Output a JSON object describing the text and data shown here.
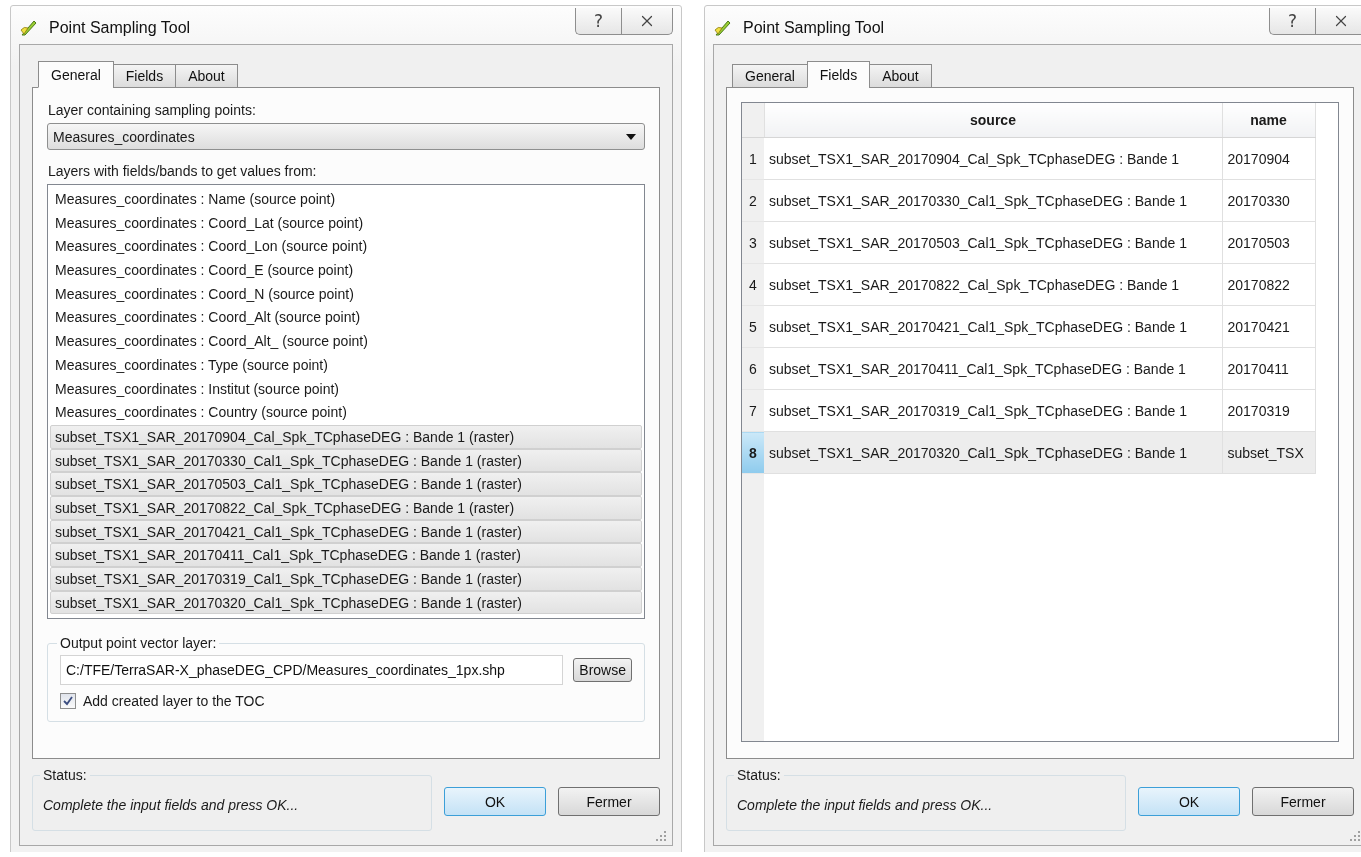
{
  "windows": [
    {
      "kind": "general",
      "title": "Point Sampling Tool",
      "help": "?",
      "tabs": [
        {
          "label": "General",
          "selected": true
        },
        {
          "label": "Fields",
          "selected": false
        },
        {
          "label": "About",
          "selected": false
        }
      ],
      "sampling_label": "Layer containing sampling points:",
      "sampling_layer": "Measures_coordinates",
      "layers_label": "Layers with fields/bands to get values from:",
      "layers": [
        {
          "label": "Measures_coordinates : Name (source point)",
          "selected": false
        },
        {
          "label": "Measures_coordinates : Coord_Lat (source point)",
          "selected": false
        },
        {
          "label": "Measures_coordinates : Coord_Lon (source point)",
          "selected": false
        },
        {
          "label": "Measures_coordinates : Coord_E (source point)",
          "selected": false
        },
        {
          "label": "Measures_coordinates : Coord_N (source point)",
          "selected": false
        },
        {
          "label": "Measures_coordinates : Coord_Alt (source point)",
          "selected": false
        },
        {
          "label": "Measures_coordinates : Coord_Alt_ (source point)",
          "selected": false
        },
        {
          "label": "Measures_coordinates : Type (source point)",
          "selected": false
        },
        {
          "label": "Measures_coordinates : Institut (source point)",
          "selected": false
        },
        {
          "label": "Measures_coordinates : Country (source point)",
          "selected": false
        },
        {
          "label": "subset_TSX1_SAR_20170904_Cal_Spk_TCphaseDEG : Bande 1 (raster)",
          "selected": true
        },
        {
          "label": "subset_TSX1_SAR_20170330_Cal1_Spk_TCphaseDEG : Bande 1 (raster)",
          "selected": true
        },
        {
          "label": "subset_TSX1_SAR_20170503_Cal1_Spk_TCphaseDEG : Bande 1 (raster)",
          "selected": true
        },
        {
          "label": "subset_TSX1_SAR_20170822_Cal_Spk_TCphaseDEG : Bande 1 (raster)",
          "selected": true
        },
        {
          "label": "subset_TSX1_SAR_20170421_Cal1_Spk_TCphaseDEG : Bande 1 (raster)",
          "selected": true
        },
        {
          "label": "subset_TSX1_SAR_20170411_Cal1_Spk_TCphaseDEG : Bande 1 (raster)",
          "selected": true
        },
        {
          "label": "subset_TSX1_SAR_20170319_Cal1_Spk_TCphaseDEG : Bande 1 (raster)",
          "selected": true
        },
        {
          "label": "subset_TSX1_SAR_20170320_Cal1_Spk_TCphaseDEG : Bande 1 (raster)",
          "selected": true
        }
      ],
      "output": {
        "legend": "Output point vector layer:",
        "path": "C:/TFE/TerraSAR-X_phaseDEG_CPD/Measures_coordinates_1px.shp",
        "browse": "Browse",
        "add_label": "Add created layer to the TOC",
        "checked": true
      },
      "status": {
        "legend": "Status:",
        "message": "Complete the input fields and press OK..."
      },
      "buttons": [
        "OK",
        "Fermer"
      ]
    },
    {
      "kind": "fields",
      "title": "Point Sampling Tool",
      "help": "?",
      "tabs": [
        {
          "label": "General",
          "selected": false
        },
        {
          "label": "Fields",
          "selected": true
        },
        {
          "label": "About",
          "selected": false
        }
      ],
      "table": {
        "columns": [
          "source",
          "name"
        ],
        "rows": [
          {
            "number": "1",
            "source": "subset_TSX1_SAR_20170904_Cal_Spk_TCphaseDEG : Bande 1",
            "name": "20170904",
            "selected": false
          },
          {
            "number": "2",
            "source": "subset_TSX1_SAR_20170330_Cal1_Spk_TCphaseDEG : Bande 1",
            "name": "20170330",
            "selected": false
          },
          {
            "number": "3",
            "source": "subset_TSX1_SAR_20170503_Cal1_Spk_TCphaseDEG : Bande 1",
            "name": "20170503",
            "selected": false
          },
          {
            "number": "4",
            "source": "subset_TSX1_SAR_20170822_Cal_Spk_TCphaseDEG : Bande 1",
            "name": "20170822",
            "selected": false
          },
          {
            "number": "5",
            "source": "subset_TSX1_SAR_20170421_Cal1_Spk_TCphaseDEG : Bande 1",
            "name": "20170421",
            "selected": false
          },
          {
            "number": "6",
            "source": "subset_TSX1_SAR_20170411_Cal1_Spk_TCphaseDEG : Bande 1",
            "name": "20170411",
            "selected": false
          },
          {
            "number": "7",
            "source": "subset_TSX1_SAR_20170319_Cal1_Spk_TCphaseDEG : Bande 1",
            "name": "20170319",
            "selected": false
          },
          {
            "number": "8",
            "source": "subset_TSX1_SAR_20170320_Cal1_Spk_TCphaseDEG : Bande 1",
            "name": "subset_TSX",
            "selected": true
          }
        ]
      },
      "status": {
        "legend": "Status:",
        "message": "Complete the input fields and press OK..."
      },
      "buttons": [
        "OK",
        "Fermer"
      ]
    }
  ]
}
